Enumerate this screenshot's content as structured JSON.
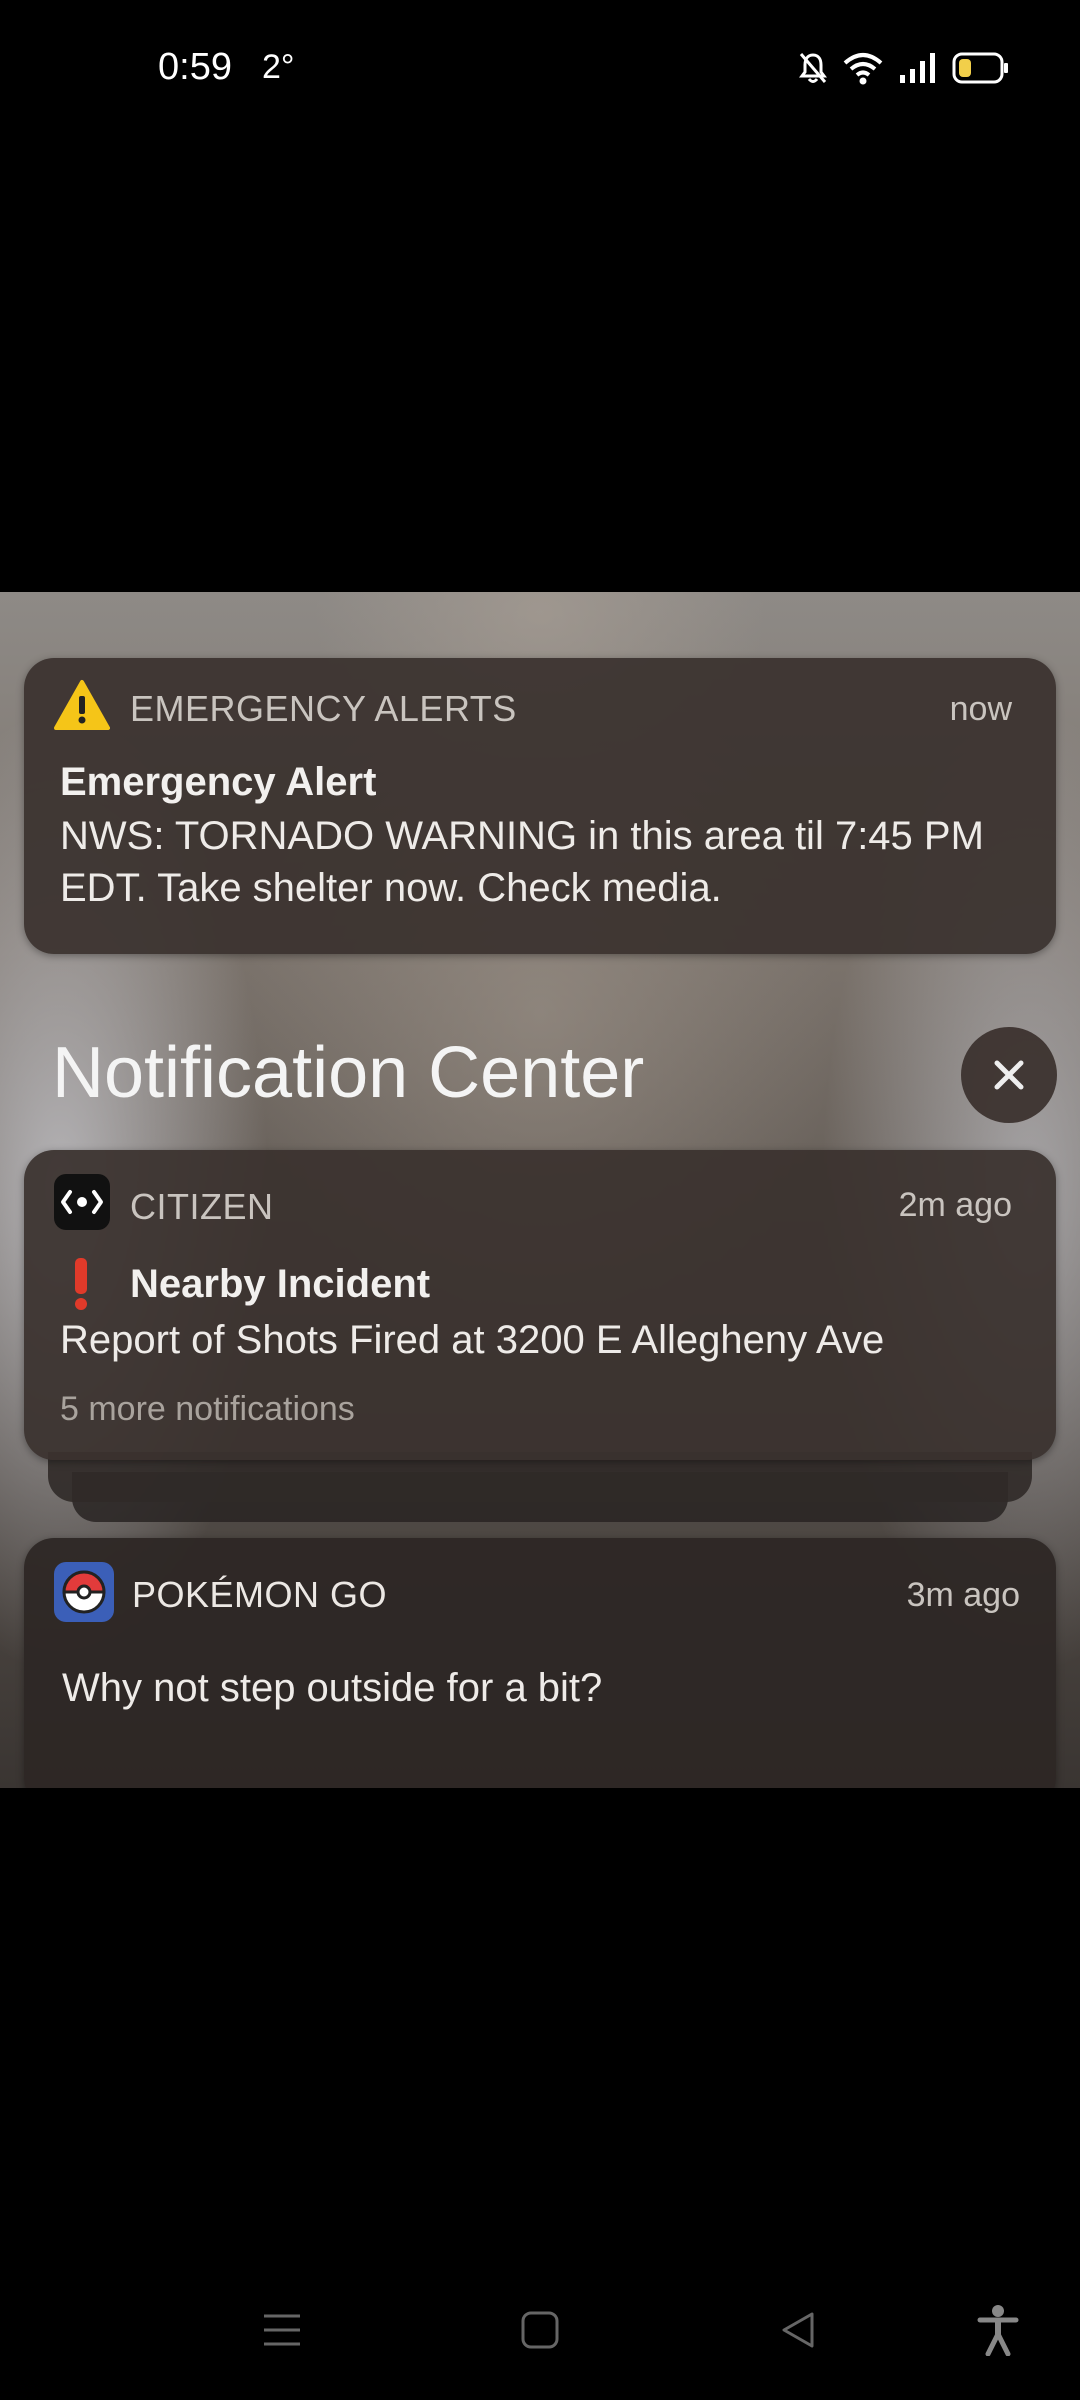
{
  "status_bar": {
    "time": "0:59",
    "temperature": "2°",
    "icons": [
      "bell-off-icon",
      "wifi-icon",
      "signal-icon",
      "battery-icon"
    ]
  },
  "screenshot": {
    "emergency": {
      "app_name": "EMERGENCY ALERTS",
      "time": "now",
      "title": "Emergency Alert",
      "body": "NWS: TORNADO WARNING in this area til 7:45 PM EDT. Take shelter now. Check media.",
      "icon": "warning-icon"
    },
    "notification_center": {
      "title": "Notification Center",
      "close_icon": "close-icon"
    },
    "citizen": {
      "app_name": "CITIZEN",
      "time": "2m ago",
      "title": "Nearby Incident",
      "body": "Report of Shots Fired at 3200 E Allegheny Ave",
      "more": "5 more notifications",
      "icon": "citizen-app-icon"
    },
    "pokemon": {
      "app_name": "POKÉMON GO",
      "time": "3m ago",
      "body": "Why not step outside for a bit?",
      "icon": "pokeball-icon"
    }
  },
  "nav_bar": {
    "items": [
      "menu-icon",
      "home-icon",
      "back-icon",
      "accessibility-icon"
    ]
  },
  "colors": {
    "warning": "#f5c518",
    "exclaim": "#e03a2a",
    "card": "#3a322e"
  }
}
